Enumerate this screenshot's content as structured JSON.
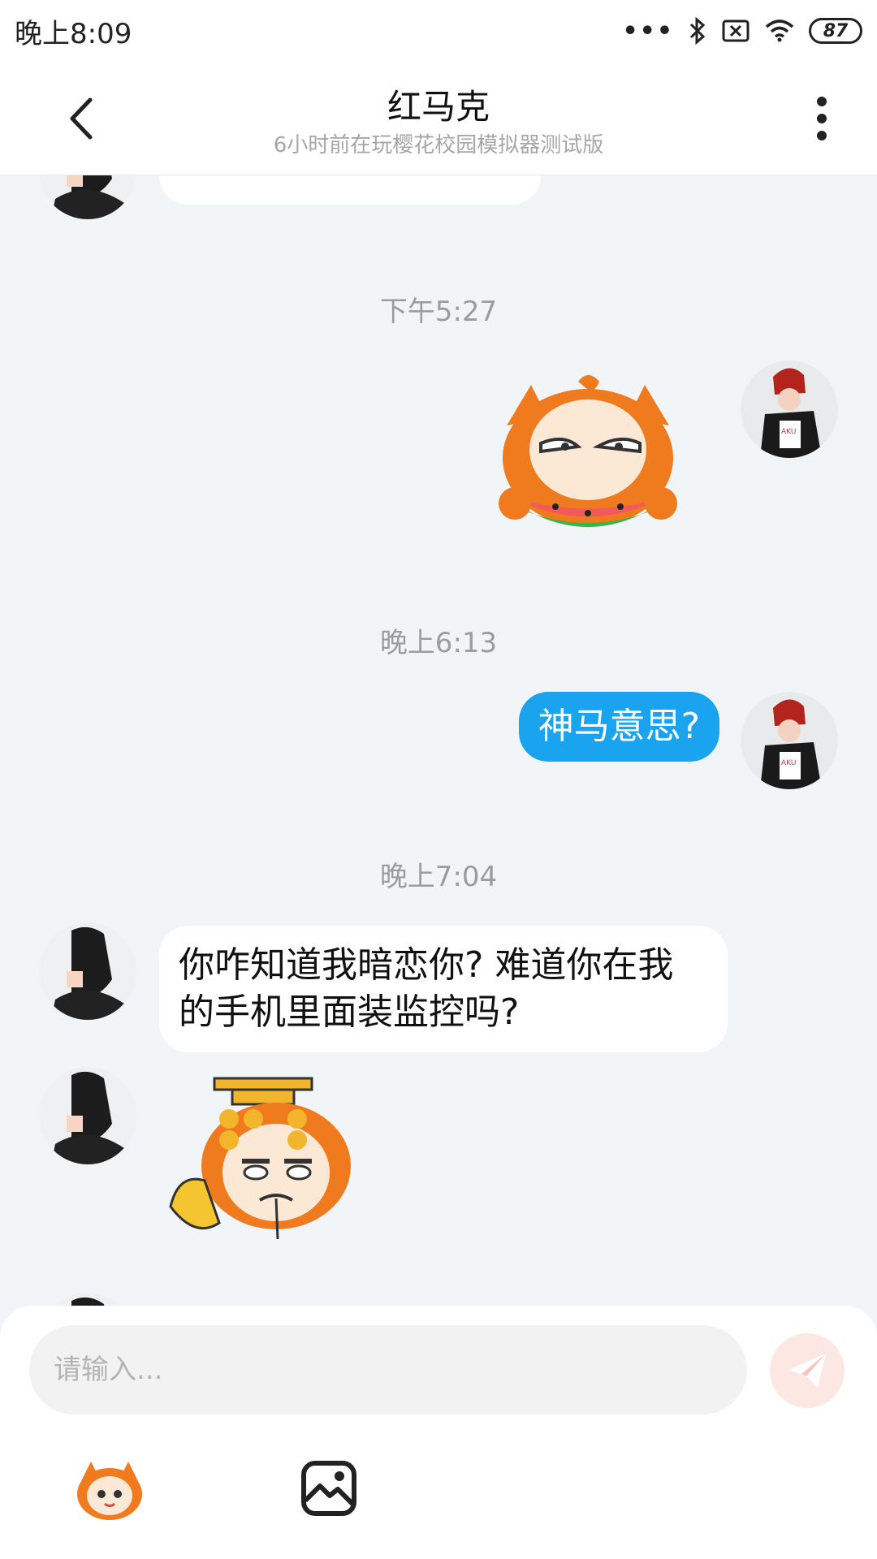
{
  "status_bar": {
    "time": "晚上8:09",
    "dots": "•••",
    "battery": "87"
  },
  "header": {
    "title": "红马克",
    "subtitle": "6小时前在玩樱花校园模拟器测试版"
  },
  "messages": {
    "timestamp_1": "下午5:27",
    "timestamp_2": "晚上6:13",
    "sent_text_1": "神马意思?",
    "timestamp_3": "晚上7:04",
    "received_text_1": "你咋知道我暗恋你? 难道你在我的手机里面装监控吗?"
  },
  "input": {
    "placeholder": "请输入..."
  },
  "colors": {
    "sent_bubble": "#1aa3ef",
    "send_button": "#fde7e3",
    "sticker_orange": "#f07a1e"
  }
}
